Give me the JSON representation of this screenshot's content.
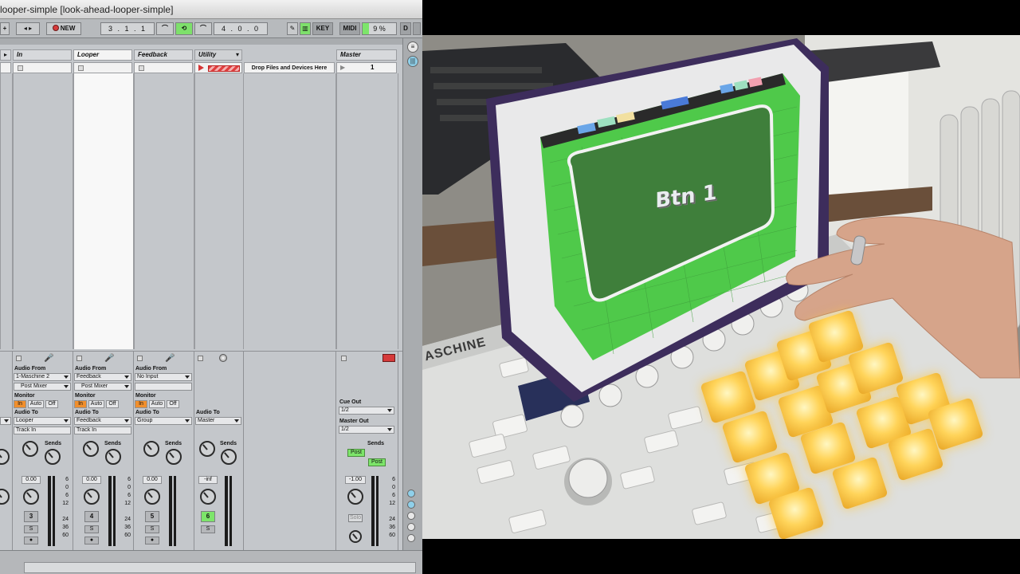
{
  "window": {
    "title": "looper-simple  [look-ahead-looper-simple]"
  },
  "toolbar": {
    "new_label": "NEW",
    "position": "3 .  1 .  1",
    "loop_length": "4 .  0 .  0",
    "key_label": "KEY",
    "midi_label": "MIDI",
    "cpu": "9 %",
    "d_label": "D"
  },
  "tracks": [
    {
      "name": "In"
    },
    {
      "name": "Looper"
    },
    {
      "name": "Feedback"
    },
    {
      "name": "Utility"
    },
    {
      "name": "Master"
    }
  ],
  "clip_slots": {
    "drop_text": "Drop Files and Devices Here",
    "master_scene": "1"
  },
  "io": {
    "audio_from_label": "Audio From",
    "monitor_label": "Monitor",
    "audio_to_label": "Audio To",
    "mon_in": "In",
    "mon_auto": "Auto",
    "mon_off": "Off",
    "in": {
      "from": "1-Maschine 2",
      "from_ch": "Post Mixer",
      "to": "Looper",
      "to_ch": "Track In"
    },
    "looper": {
      "from": "Feedback",
      "from_ch": "Post Mixer",
      "to": "Feedback",
      "to_ch": "Track In"
    },
    "feedback": {
      "from": "No Input",
      "to": "Group"
    },
    "utility": {
      "to": "Master"
    },
    "master": {
      "cue_out_label": "Cue Out",
      "cue_out": "1/2",
      "master_out_label": "Master Out",
      "master_out": "1/2"
    }
  },
  "mixer": {
    "sends_label": "Sends",
    "send_a": "A",
    "send_b": "B",
    "post_label": "Post",
    "vol_in": "0.00",
    "vol_looper": "0.00",
    "vol_feedback": "0.00",
    "vol_utility": "-inf",
    "vol_master": "-1.00",
    "num_in": "3",
    "num_looper": "4",
    "num_feedback": "5",
    "num_utility": "6",
    "solo_label": "S",
    "master_solo_label": "Solo",
    "scale": [
      "6",
      "0",
      "6",
      "12",
      "24",
      "36",
      "60"
    ]
  },
  "footage": {
    "ipad_button_text": "Btn 1",
    "brand_text": "ASCHINE"
  },
  "colors": {
    "accent_green": "#7de56a",
    "monitor_orange": "#f08f2d",
    "clip_red": "#e04040",
    "pad_glow": "#ffd45a",
    "ipad_screen": "#4fc94a"
  }
}
